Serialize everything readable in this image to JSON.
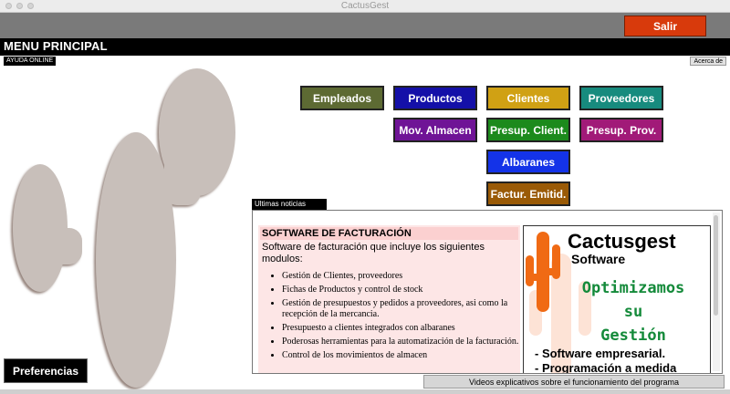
{
  "window": {
    "title": "CactusGest"
  },
  "header": {
    "exit_label": "Salir",
    "menu_title": "MENU PRINCIPAL",
    "help_label": "AYUDA ONLINE",
    "about_label": "Acerca de"
  },
  "menu_buttons": [
    {
      "label": "Empleados",
      "color": "#5d6a33"
    },
    {
      "label": "Productos",
      "color": "#1410a8"
    },
    {
      "label": "Clientes",
      "color": "#d0a114"
    },
    {
      "label": "Proveedores",
      "color": "#178b7e"
    },
    {
      "label": "Mov. Almacen",
      "color": "#6f1496"
    },
    {
      "label": "Presup. Client.",
      "color": "#1c8a1c"
    },
    {
      "label": "Presup. Prov.",
      "color": "#a11a78"
    },
    {
      "label": "Albaranes",
      "color": "#1433e8"
    },
    {
      "label": "Factur. Emitid.",
      "color": "#9a5a06"
    }
  ],
  "news": {
    "tab_label": "Ultimas noticias",
    "heading": "SOFTWARE DE FACTURACIÓN",
    "intro": "Software de facturación que incluye los siguientes modulos:",
    "items": [
      "Gestión de Clientes, proveedores",
      "Fichas de Productos y control de stock",
      "Gestión de presupuestos y pedidos a proveedores, asi como la recepción de la mercancia.",
      "Presupuesto a clientes integrados con albaranes",
      "Poderosas herramientas para la  automatización de la facturación.",
      "Control de los movimientos de almacen"
    ],
    "ad": {
      "brand": "Cactusgest",
      "sub": "Software",
      "slogan": [
        "Optimizamos",
        "su",
        "Gestión"
      ],
      "bullets": [
        "- Software empresarial.",
        "- Programación a medida"
      ]
    }
  },
  "footer": {
    "videos_label": "Videos explicativos sobre el funcionamiento del programa",
    "preferences_label": "Preferencias"
  },
  "colors": {
    "cactus": "#c8bfba",
    "cactus_outline": "#8a7870",
    "ad_cactus": "#f06a14",
    "slogan": "#148a3a",
    "exit_button": "#d83a0c"
  }
}
